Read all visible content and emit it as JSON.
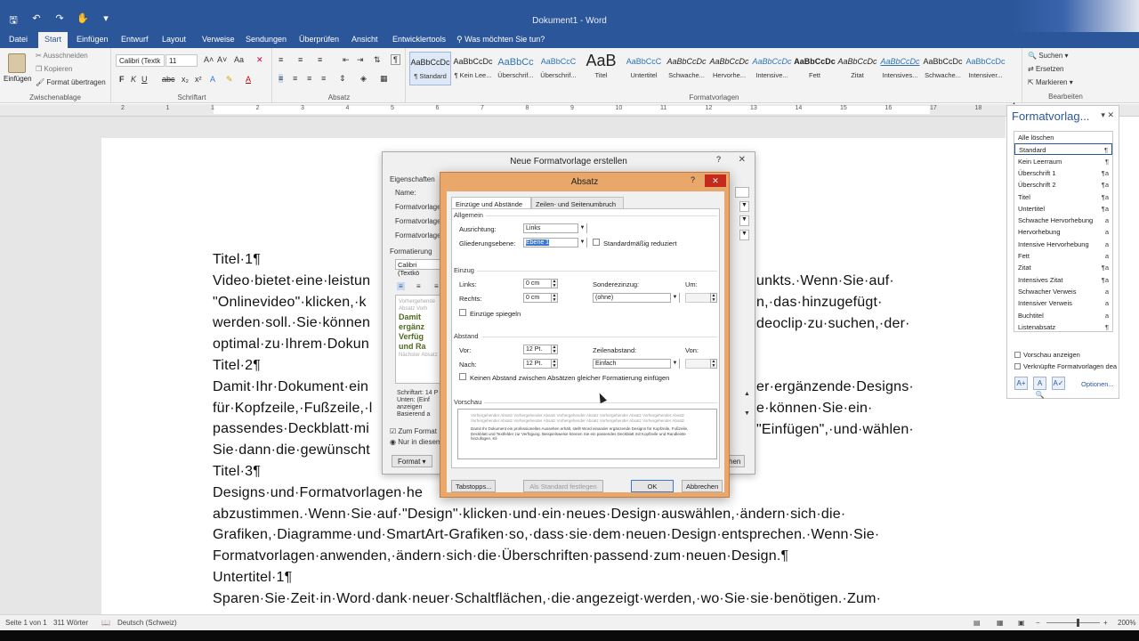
{
  "window": {
    "title": "Dokument1 - Word",
    "qat": [
      "save-icon",
      "undo-icon",
      "redo-icon",
      "touch-icon",
      "qat-menu-icon"
    ],
    "colors": {
      "accent": "#2b579a",
      "dialog_highlight": "#e9a86a",
      "close": "#c42b1c"
    }
  },
  "tabs": [
    "Datei",
    "Start",
    "Einfügen",
    "Entwurf",
    "Layout",
    "Verweise",
    "Sendungen",
    "Überprüfen",
    "Ansicht",
    "Entwicklertools",
    "Was möchten Sie tun?"
  ],
  "ribbon": {
    "clipboard": {
      "paste": "Einfügen",
      "cut": "Ausschneiden",
      "copy": "Kopieren",
      "format_painter": "Format übertragen",
      "label": "Zwischenablage"
    },
    "font": {
      "name": "Calibri (Textk",
      "size": "11",
      "label": "Schriftart"
    },
    "paragraph": {
      "label": "Absatz"
    },
    "styles": {
      "label": "Formatvorlagen",
      "items": [
        {
          "preview": "AaBbCcDc",
          "name": "¶ Standard"
        },
        {
          "preview": "AaBbCcDc",
          "name": "¶ Kein Lee..."
        },
        {
          "preview": "AaBbCc",
          "name": "Überschrif..."
        },
        {
          "preview": "AaBbCcC",
          "name": "Überschrif..."
        },
        {
          "preview": "AaB",
          "name": "Titel"
        },
        {
          "preview": "AaBbCcC",
          "name": "Untertitel"
        },
        {
          "preview": "AaBbCcDc",
          "name": "Schwache..."
        },
        {
          "preview": "AaBbCcDc",
          "name": "Hervorhe..."
        },
        {
          "preview": "AaBbCcDc",
          "name": "Intensive..."
        },
        {
          "preview": "AaBbCcDc",
          "name": "Fett"
        },
        {
          "preview": "AaBbCcDc",
          "name": "Zitat"
        },
        {
          "preview": "AaBbCcDc",
          "name": "Intensives..."
        },
        {
          "preview": "AaBbCcDc",
          "name": "Schwache..."
        },
        {
          "preview": "AaBbCcDc",
          "name": "Intensiver..."
        }
      ]
    },
    "editing": {
      "find": "Suchen",
      "replace": "Ersetzen",
      "select": "Markieren",
      "label": "Bearbeiten"
    }
  },
  "ruler": {
    "numbers": [
      "2",
      "1",
      "1",
      "2",
      "3",
      "4",
      "5",
      "6",
      "7",
      "8",
      "9",
      "10",
      "11",
      "12",
      "13",
      "14",
      "15",
      "16",
      "17",
      "18"
    ]
  },
  "document": {
    "lines": [
      "Titel·1¶",
      "Video·bietet·eine·leistun",
      "\"Onlinevideo\"·klicken,·k",
      "werden·soll.·Sie·können",
      "optimal·zu·Ihrem·Dokun",
      "Titel·2¶",
      "Damit·Ihr·Dokument·ein",
      "für·Kopfzeile,·Fußzeile,·l",
      "passendes·Deckblatt·mi",
      "Sie·dann·die·gewünscht",
      "Titel·3¶",
      "Designs·und·Formatvorlagen·he",
      "abzustimmen.·Wenn·Sie·auf·\"Design\"·klicken·und·ein·neues·Design·auswählen,·ändern·sich·die·",
      "Grafiken,·Diagramme·und·SmartArt-Grafiken·so,·dass·sie·dem·neuen·Design·entsprechen.·Wenn·Sie·",
      "Formatvorlagen·anwenden,·ändern·sich·die·Überschriften·passend·zum·neuen·Design.¶",
      "Untertitel·1¶",
      "Sparen·Sie·Zeit·in·Word·dank·neuer·Schaltflächen,·die·angezeigt·werden,·wo·Sie·sie·benötigen.·Zum·"
    ],
    "right_fragments": [
      "unkts.·Wenn·Sie·auf·",
      "n,·das·hinzugefügt·",
      "deoclip·zu·suchen,·der·",
      "er·ergänzende·Designs·",
      "e·können·Sie·ein·",
      "\"Einfügen\",·und·wählen·"
    ]
  },
  "styles_pane": {
    "title": "Formatvorlag...",
    "items": [
      {
        "name": "Alle löschen",
        "glyph": ""
      },
      {
        "name": "Standard",
        "glyph": "¶"
      },
      {
        "name": "Kein Leerraum",
        "glyph": "¶"
      },
      {
        "name": "Überschrift 1",
        "glyph": "¶a"
      },
      {
        "name": "Überschrift 2",
        "glyph": "¶a"
      },
      {
        "name": "Titel",
        "glyph": "¶a"
      },
      {
        "name": "Untertitel",
        "glyph": "¶a"
      },
      {
        "name": "Schwache Hervorhebung",
        "glyph": "a"
      },
      {
        "name": "Hervorhebung",
        "glyph": "a"
      },
      {
        "name": "Intensive Hervorhebung",
        "glyph": "a"
      },
      {
        "name": "Fett",
        "glyph": "a"
      },
      {
        "name": "Zitat",
        "glyph": "¶a"
      },
      {
        "name": "Intensives Zitat",
        "glyph": "¶a"
      },
      {
        "name": "Schwacher Verweis",
        "glyph": "a"
      },
      {
        "name": "Intensiver Verweis",
        "glyph": "a"
      },
      {
        "name": "Buchtitel",
        "glyph": "a"
      },
      {
        "name": "Listenabsatz",
        "glyph": "¶"
      }
    ],
    "show_preview": "Vorschau anzeigen",
    "linked": "Verknüpfte Formatvorlagen dea",
    "options": "Optionen..."
  },
  "status": {
    "page": "Seite 1 von 1",
    "words": "311 Wörter",
    "language": "Deutsch (Schweiz)",
    "zoom": "200%"
  },
  "dialog_new_style": {
    "title": "Neue Formatvorlage erstellen",
    "help": "?",
    "props": "Eigenschaften",
    "name": "Name:",
    "type": "Formatvorlage",
    "base": "Formatvorlage",
    "next": "Formatvorlage",
    "formatting": "Formatierung",
    "font": "Calibri (Textkö",
    "preview_gray1": "Vorhergehende",
    "preview_gray2": "Absatz Vorh",
    "preview_bold": "Damit ergänz Verfüg und Ra",
    "preview_gray3": "Nächster Absatz",
    "desc": "Schriftart: 14 P Unten: (Einf anzeigen Basierend a",
    "add_to": "Zum Format",
    "only_in": "Nur in diesem",
    "format_btn": "Format ▾",
    "cancel_fragment": "hen"
  },
  "dialog_paragraph": {
    "title": "Absatz",
    "help": "?",
    "tabs": [
      "Einzüge und Abstände",
      "Zeilen- und Seitenumbruch"
    ],
    "general": "Allgemein",
    "alignment_label": "Ausrichtung:",
    "alignment_value": "Links",
    "outline_label": "Gliederungsebene:",
    "outline_value": "Ebene 1",
    "collapsed_label": "Standardmäßig reduziert",
    "indent": "Einzug",
    "left_label": "Links:",
    "left_value": "0 cm",
    "right_label": "Rechts:",
    "right_value": "0 cm",
    "special_label": "Sonderezinzug:",
    "special_value": "(ohne)",
    "by_label": "Um:",
    "mirror_label": "Einzüge spiegeln",
    "spacing": "Abstand",
    "before_label": "Vor:",
    "before_value": "12 Pt.",
    "after_label": "Nach:",
    "after_value": "12 Pt.",
    "line_label": "Zeilenabstand:",
    "line_value": "Einfach",
    "at_label": "Von:",
    "no_space_label": "Keinen Abstand zwischen Absätzen gleicher Formatierung einfügen",
    "preview": "Vorschau",
    "preview_prev": "Vorhergehender Absatz Vorhergehender Absatz Vorhergehender Absatz Vorhergehender Absatz Vorhergehender Absatz Vorhergehender Absatz Vorhergehender Absatz Vorhergehender Absatz Vorhergehender Absatz Vorhergehender Absatz",
    "preview_cur": "Damit Ihr Dokument ein professionelles Aussehen erhält, stellt Word einander ergänzende Designs für Kopfzeile, Fußzeile, Deckblatt und Textfelder zur Verfügung. Beispielsweise können Sie ein passendes Deckblatt mit Kopfzeile und Randleiste hinzufügen. Kli",
    "tabs_btn": "Tabstopps...",
    "default_btn": "Als Standard festlegen",
    "ok_btn": "OK",
    "cancel_btn": "Abbrechen"
  }
}
